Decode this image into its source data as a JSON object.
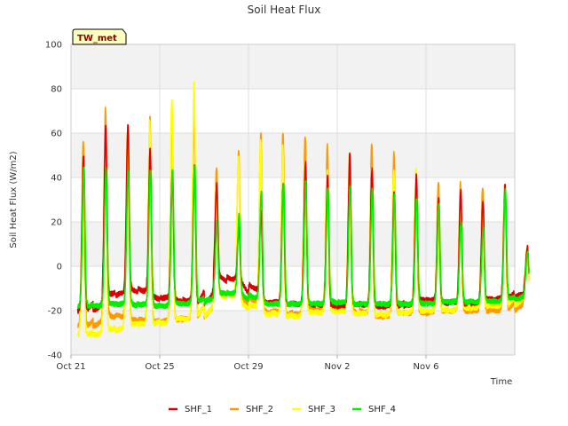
{
  "chart_data": {
    "type": "line",
    "title": "Soil Heat Flux",
    "xlabel": "Time",
    "ylabel": "Soil Heat Flux (W/m2)",
    "site_badge": "TW_met",
    "ylim": [
      -40,
      100
    ],
    "xlim": [
      "2023-10-21",
      "2023-11-10"
    ],
    "yticks": [
      "-40",
      "-20",
      "0",
      "20",
      "40",
      "60",
      "80",
      "100"
    ],
    "xticks": [
      {
        "date": "2023-10-21",
        "label": "Oct 21"
      },
      {
        "date": "2023-10-25",
        "label": "Oct 25"
      },
      {
        "date": "2023-10-29",
        "label": "Oct 29"
      },
      {
        "date": "2023-11-02",
        "label": "Nov 2"
      },
      {
        "date": "2023-11-06",
        "label": "Nov 6"
      }
    ],
    "grid": true,
    "background_bands": "alternating",
    "legend_position": "bottom",
    "series": [
      {
        "name": "SHF_1",
        "color": "#dd0000",
        "daily_peaks": [
          55,
          69,
          70,
          58,
          47,
          50,
          40,
          20,
          28,
          42,
          52,
          45,
          55,
          49,
          38,
          45,
          34,
          38,
          33,
          40,
          10
        ],
        "daily_mins": [
          -20,
          -13,
          -10,
          -14,
          -15,
          -17,
          -5,
          -8,
          -16,
          -17,
          -17,
          -18,
          -17,
          -18,
          -18,
          -15,
          -16,
          -17,
          -15,
          -14,
          -10
        ]
      },
      {
        "name": "SHF_2",
        "color": "#ff9900",
        "daily_peaks": [
          63,
          78,
          66,
          75,
          75,
          76,
          48,
          57,
          66,
          67,
          65,
          60,
          56,
          62,
          56,
          35,
          42,
          42,
          40,
          41,
          10
        ],
        "daily_mins": [
          -27,
          -22,
          -24,
          -25,
          -24,
          -23,
          -12,
          -14,
          -20,
          -22,
          -20,
          -18,
          -20,
          -23,
          -21,
          -21,
          -20,
          -20,
          -20,
          -20,
          -12
        ]
      },
      {
        "name": "SHF_3",
        "color": "#ffff00",
        "daily_peaks": [
          33,
          50,
          67,
          72,
          83,
          91,
          38,
          55,
          62,
          60,
          52,
          48,
          49,
          48,
          48,
          50,
          28,
          30,
          27,
          38,
          8
        ],
        "daily_mins": [
          -31,
          -29,
          -26,
          -26,
          -24,
          -23,
          -12,
          -17,
          -21,
          -23,
          -21,
          -20,
          -21,
          -22,
          -21,
          -20,
          -20,
          -19,
          -18,
          -18,
          -10
        ]
      },
      {
        "name": "SHF_4",
        "color": "#00ee00",
        "daily_peaks": [
          50,
          48,
          49,
          48,
          48,
          50,
          22,
          26,
          38,
          42,
          42,
          39,
          40,
          38,
          36,
          35,
          32,
          23,
          20,
          38,
          8
        ],
        "daily_mins": [
          -18,
          -17,
          -17,
          -18,
          -17,
          -16,
          -12,
          -13,
          -17,
          -17,
          -17,
          -16,
          -17,
          -17,
          -17,
          -17,
          -16,
          -16,
          -16,
          -15,
          -12
        ]
      }
    ]
  }
}
